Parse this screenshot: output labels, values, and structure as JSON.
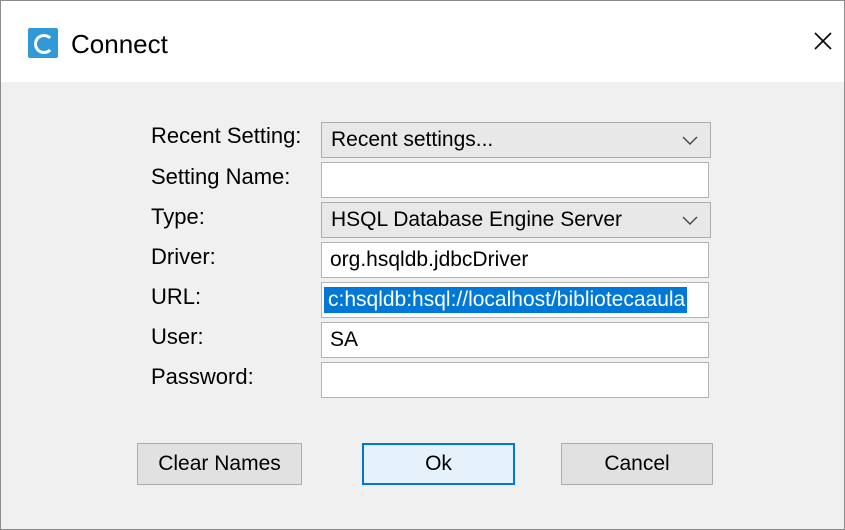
{
  "window": {
    "title": "Connect"
  },
  "form": {
    "recent_setting": {
      "label": "Recent Setting:",
      "value": "Recent settings..."
    },
    "setting_name": {
      "label": "Setting Name:",
      "value": ""
    },
    "type": {
      "label": "Type:",
      "value": "HSQL Database Engine Server"
    },
    "driver": {
      "label": "Driver:",
      "value": "org.hsqldb.jdbcDriver"
    },
    "url": {
      "label": "URL:",
      "value": "c:hsqldb:hsql://localhost/bibliotecaaula"
    },
    "user": {
      "label": "User:",
      "value": "SA"
    },
    "password": {
      "label": "Password:",
      "value": ""
    }
  },
  "buttons": {
    "clear_names": "Clear Names",
    "ok": "Ok",
    "cancel": "Cancel"
  },
  "icons": {
    "app": "hsqldb-app-icon",
    "close": "close-icon",
    "dropdown": "chevron-down-icon"
  },
  "colors": {
    "selection": "#0078d7",
    "default_button_border": "#0078d7",
    "dialog_background": "#f0f0f0"
  }
}
